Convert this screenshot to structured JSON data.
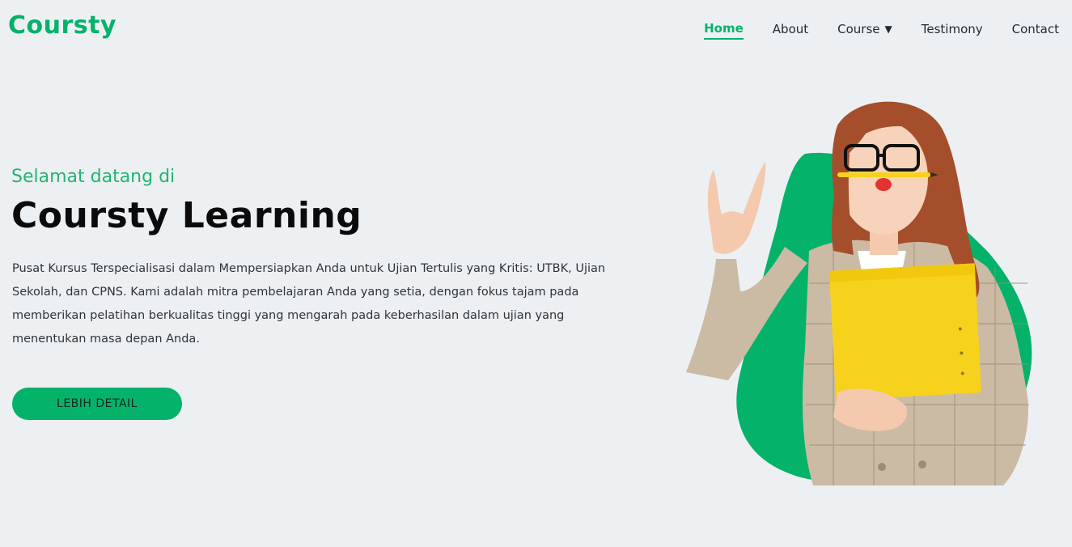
{
  "header": {
    "logo": "Coursty",
    "nav": [
      {
        "label": "Home",
        "active": true
      },
      {
        "label": "About"
      },
      {
        "label": "Course",
        "caret": "▼"
      },
      {
        "label": "Testimony"
      },
      {
        "label": "Contact"
      }
    ]
  },
  "hero": {
    "subtitle": "Selamat datang di",
    "title": "Coursty Learning",
    "description": "Pusat Kursus Terspecialisasi dalam Mempersiapkan Anda untuk Ujian Tertulis yang Kritis: UTBK, Ujian Sekolah, dan CPNS. Kami adalah mitra pembelajaran Anda yang setia, dengan fokus tajam pada memberikan pelatihan berkualitas tinggi yang mengarah pada keberhasilan dalam ujian yang menentukan masa depan Anda.",
    "cta_label": "LEBIH DETAIL",
    "illustration_icon": "woman-with-yellow-folder-illustration"
  },
  "colors": {
    "brand": "#05b26a",
    "background": "#edf0f3",
    "folder": "#f7d21c"
  }
}
